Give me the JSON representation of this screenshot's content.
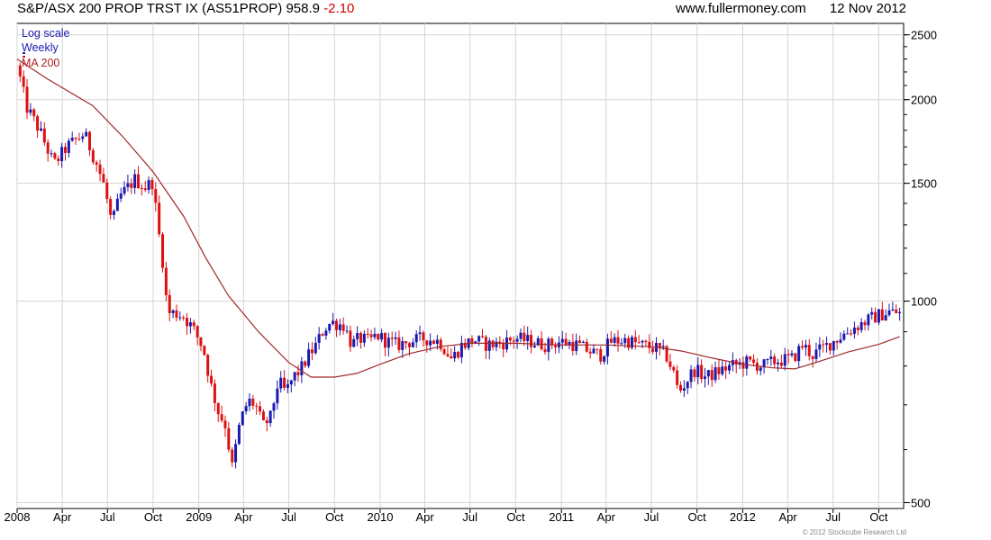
{
  "header": {
    "title": "S&P/ASX 200 PROP TRST IX (AS51PROP)",
    "last": "958.9",
    "change": "-2.10",
    "site": "www.fullermoney.com",
    "date": "12 Nov 2012"
  },
  "legend": {
    "scale": "Log scale",
    "period": "Weekly",
    "ma": "MA 200"
  },
  "copyright": "© 2012 Stockcube Research Ltd",
  "colors": {
    "up": "#1a1ab0",
    "down": "#dd1111",
    "ma": "#a0282a",
    "grid": "#d4d4d4",
    "axis": "#000000"
  },
  "chart_data": {
    "type": "candlestick",
    "title": "S&P/ASX 200 PROP TRST IX (AS51PROP)",
    "y_scale": "log",
    "ylim": [
      490,
      2600
    ],
    "yticks": [
      500,
      1000,
      1500,
      2000,
      2500
    ],
    "x_range": [
      "2008-01-01",
      "2012-11-20"
    ],
    "x_ticks": [
      {
        "d": "2008-01-01",
        "label": "2008"
      },
      {
        "d": "2008-04-01",
        "label": "Apr"
      },
      {
        "d": "2008-07-01",
        "label": "Jul"
      },
      {
        "d": "2008-10-01",
        "label": "Oct"
      },
      {
        "d": "2009-01-01",
        "label": "2009"
      },
      {
        "d": "2009-04-01",
        "label": "Apr"
      },
      {
        "d": "2009-07-01",
        "label": "Jul"
      },
      {
        "d": "2009-10-01",
        "label": "Oct"
      },
      {
        "d": "2010-01-01",
        "label": "2010"
      },
      {
        "d": "2010-04-01",
        "label": "Apr"
      },
      {
        "d": "2010-07-01",
        "label": "Jul"
      },
      {
        "d": "2010-10-01",
        "label": "Oct"
      },
      {
        "d": "2011-01-01",
        "label": "2011"
      },
      {
        "d": "2011-04-01",
        "label": "Apr"
      },
      {
        "d": "2011-07-01",
        "label": "Jul"
      },
      {
        "d": "2011-10-01",
        "label": "Oct"
      },
      {
        "d": "2012-01-01",
        "label": "2012"
      },
      {
        "d": "2012-04-01",
        "label": "Apr"
      },
      {
        "d": "2012-07-01",
        "label": "Jul"
      },
      {
        "d": "2012-10-01",
        "label": "Oct"
      }
    ],
    "close_path": [
      [
        "2008-01-01",
        2250
      ],
      [
        "2008-01-20",
        1950
      ],
      [
        "2008-02-15",
        1800
      ],
      [
        "2008-03-15",
        1600
      ],
      [
        "2008-04-10",
        1700
      ],
      [
        "2008-05-15",
        1780
      ],
      [
        "2008-06-10",
        1600
      ],
      [
        "2008-06-25",
        1480
      ],
      [
        "2008-07-10",
        1300
      ],
      [
        "2008-07-25",
        1430
      ],
      [
        "2008-08-25",
        1520
      ],
      [
        "2008-09-15",
        1480
      ],
      [
        "2008-09-30",
        1510
      ],
      [
        "2008-10-10",
        1300
      ],
      [
        "2008-10-20",
        1150
      ],
      [
        "2008-10-30",
        960
      ],
      [
        "2008-11-15",
        960
      ],
      [
        "2008-12-01",
        950
      ],
      [
        "2008-12-20",
        910
      ],
      [
        "2009-01-10",
        850
      ],
      [
        "2009-01-25",
        750
      ],
      [
        "2009-02-10",
        680
      ],
      [
        "2009-02-25",
        650
      ],
      [
        "2009-03-08",
        560
      ],
      [
        "2009-03-25",
        660
      ],
      [
        "2009-04-10",
        710
      ],
      [
        "2009-04-25",
        700
      ],
      [
        "2009-05-10",
        650
      ],
      [
        "2009-05-25",
        670
      ],
      [
        "2009-06-10",
        760
      ],
      [
        "2009-06-25",
        730
      ],
      [
        "2009-07-10",
        770
      ],
      [
        "2009-07-25",
        790
      ],
      [
        "2009-08-10",
        830
      ],
      [
        "2009-08-25",
        860
      ],
      [
        "2009-09-10",
        910
      ],
      [
        "2009-09-25",
        930
      ],
      [
        "2009-10-20",
        920
      ],
      [
        "2009-11-05",
        860
      ],
      [
        "2009-11-20",
        880
      ],
      [
        "2009-12-10",
        870
      ],
      [
        "2009-12-25",
        890
      ],
      [
        "2010-01-15",
        870
      ],
      [
        "2010-02-05",
        860
      ],
      [
        "2010-03-01",
        870
      ],
      [
        "2010-04-01",
        880
      ],
      [
        "2010-05-01",
        870
      ],
      [
        "2010-05-25",
        820
      ],
      [
        "2010-06-15",
        860
      ],
      [
        "2010-07-10",
        875
      ],
      [
        "2010-08-05",
        860
      ],
      [
        "2010-09-01",
        865
      ],
      [
        "2010-10-01",
        880
      ],
      [
        "2010-11-01",
        870
      ],
      [
        "2010-12-01",
        860
      ],
      [
        "2011-01-01",
        870
      ],
      [
        "2011-02-01",
        860
      ],
      [
        "2011-03-01",
        840
      ],
      [
        "2011-03-20",
        830
      ],
      [
        "2011-04-10",
        870
      ],
      [
        "2011-05-10",
        875
      ],
      [
        "2011-06-10",
        860
      ],
      [
        "2011-07-10",
        850
      ],
      [
        "2011-07-31",
        830
      ],
      [
        "2011-08-15",
        780
      ],
      [
        "2011-08-25",
        730
      ],
      [
        "2011-09-10",
        760
      ],
      [
        "2011-09-25",
        790
      ],
      [
        "2011-10-20",
        770
      ],
      [
        "2011-11-20",
        790
      ],
      [
        "2011-12-10",
        800
      ],
      [
        "2012-01-10",
        810
      ],
      [
        "2012-02-10",
        800
      ],
      [
        "2012-03-10",
        815
      ],
      [
        "2012-04-10",
        820
      ],
      [
        "2012-05-01",
        860
      ],
      [
        "2012-05-20",
        830
      ],
      [
        "2012-06-20",
        860
      ],
      [
        "2012-07-20",
        890
      ],
      [
        "2012-08-20",
        920
      ],
      [
        "2012-09-20",
        945
      ],
      [
        "2012-10-20",
        965
      ],
      [
        "2012-11-12",
        958.9
      ]
    ],
    "ma200": [
      [
        "2008-01-01",
        2300
      ],
      [
        "2008-03-01",
        2150
      ],
      [
        "2008-06-01",
        1960
      ],
      [
        "2008-08-01",
        1760
      ],
      [
        "2008-10-01",
        1560
      ],
      [
        "2008-12-01",
        1340
      ],
      [
        "2009-01-15",
        1160
      ],
      [
        "2009-03-01",
        1020
      ],
      [
        "2009-05-01",
        900
      ],
      [
        "2009-07-01",
        810
      ],
      [
        "2009-08-15",
        770
      ],
      [
        "2009-10-01",
        770
      ],
      [
        "2009-11-15",
        780
      ],
      [
        "2010-01-01",
        805
      ],
      [
        "2010-03-01",
        835
      ],
      [
        "2010-05-01",
        855
      ],
      [
        "2010-07-01",
        865
      ],
      [
        "2010-10-01",
        865
      ],
      [
        "2011-01-01",
        860
      ],
      [
        "2011-04-01",
        860
      ],
      [
        "2011-07-01",
        855
      ],
      [
        "2011-09-01",
        842
      ],
      [
        "2011-11-01",
        822
      ],
      [
        "2012-01-01",
        805
      ],
      [
        "2012-03-01",
        795
      ],
      [
        "2012-04-15",
        792
      ],
      [
        "2012-06-01",
        812
      ],
      [
        "2012-08-01",
        840
      ],
      [
        "2012-10-01",
        862
      ],
      [
        "2012-11-12",
        885
      ]
    ]
  }
}
